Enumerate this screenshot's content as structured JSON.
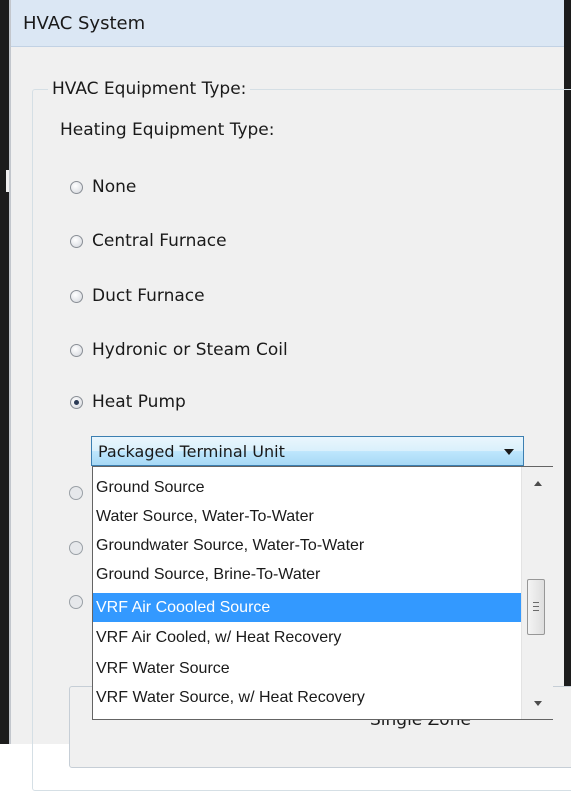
{
  "window": {
    "title": "HVAC System"
  },
  "group": {
    "legend": "HVAC Equipment Type:",
    "heating_label": "Heating Equipment Type:"
  },
  "heating_options": [
    {
      "label": "None",
      "checked": false
    },
    {
      "label": "Central Furnace",
      "checked": false
    },
    {
      "label": "Duct Furnace",
      "checked": false
    },
    {
      "label": "Hydronic or Steam Coil",
      "checked": false
    },
    {
      "label": "Heat Pump",
      "checked": true
    }
  ],
  "heat_pump_combo": {
    "selected": "Packaged Terminal Unit",
    "options": [
      "Ground Source",
      "Water Source, Water-To-Water",
      "Groundwater Source, Water-To-Water",
      "Ground Source, Brine-To-Water",
      "VRF Air Coooled Source",
      "VRF Air Cooled, w/ Heat Recovery",
      "VRF Water Source",
      "VRF Water Source, w/ Heat Recovery"
    ],
    "highlighted": "VRF Air Coooled Source"
  },
  "partially_hidden": {
    "label": "Single Zone"
  },
  "colors": {
    "highlight": "#3399ff",
    "titlebar": "#dbe7f4",
    "combo_border": "#3c7fb1"
  }
}
